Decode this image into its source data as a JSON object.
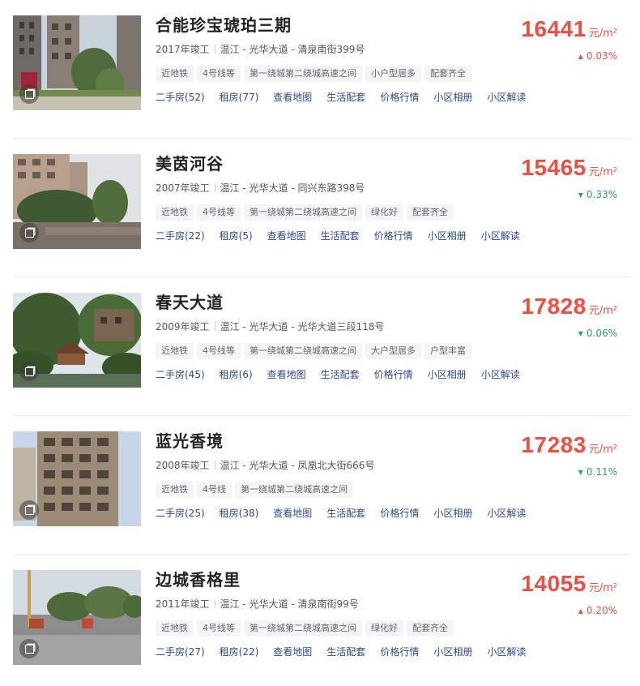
{
  "communities": [
    {
      "name": "合能珍宝琥珀三期",
      "year": "2017年竣工",
      "location": "温江 - 光华大道 - 清泉南街399号",
      "tags": [
        "近地铁",
        "4号线等",
        "第一绕城第二绕城高速之间",
        "小户型居多",
        "配套齐全"
      ],
      "links": [
        "二手房(52)",
        "租房(77)",
        "查看地图",
        "生活配套",
        "价格行情",
        "小区相册",
        "小区解读"
      ],
      "price": "16441",
      "unit": "元/m²",
      "change_dir": "up",
      "change_arrow": "▲",
      "change": "0.03%",
      "photo_icon": "photo-album-icon"
    },
    {
      "name": "美茵河谷",
      "year": "2007年竣工",
      "location": "温江 - 光华大道 - 同兴东路398号",
      "tags": [
        "近地铁",
        "4号线等",
        "第一绕城第二绕城高速之间",
        "绿化好",
        "配套齐全"
      ],
      "links": [
        "二手房(22)",
        "租房(5)",
        "查看地图",
        "生活配套",
        "价格行情",
        "小区相册",
        "小区解读"
      ],
      "price": "15465",
      "unit": "元/m²",
      "change_dir": "down",
      "change_arrow": "▼",
      "change": "0.33%",
      "photo_icon": "photo-album-icon"
    },
    {
      "name": "春天大道",
      "year": "2009年竣工",
      "location": "温江 - 光华大道 - 光华大道三段118号",
      "tags": [
        "近地铁",
        "4号线等",
        "第一绕城第二绕城高速之间",
        "大户型居多",
        "户型丰富"
      ],
      "links": [
        "二手房(45)",
        "租房(6)",
        "查看地图",
        "生活配套",
        "价格行情",
        "小区相册",
        "小区解读"
      ],
      "price": "17828",
      "unit": "元/m²",
      "change_dir": "down",
      "change_arrow": "▼",
      "change": "0.06%",
      "photo_icon": "photo-album-icon"
    },
    {
      "name": "蓝光香境",
      "year": "2008年竣工",
      "location": "温江 - 光华大道 - 凤凰北大街666号",
      "tags": [
        "近地铁",
        "4号线",
        "第一绕城第二绕城高速之间"
      ],
      "links": [
        "二手房(25)",
        "租房(38)",
        "查看地图",
        "生活配套",
        "价格行情",
        "小区相册",
        "小区解读"
      ],
      "price": "17283",
      "unit": "元/m²",
      "change_dir": "down",
      "change_arrow": "▼",
      "change": "0.11%",
      "photo_icon": "photo-album-icon"
    },
    {
      "name": "边城香格里",
      "year": "2011年竣工",
      "location": "温江 - 光华大道 - 清泉南街99号",
      "tags": [
        "近地铁",
        "4号线等",
        "第一绕城第二绕城高速之间",
        "绿化好",
        "配套齐全"
      ],
      "links": [
        "二手房(27)",
        "租房(22)",
        "查看地图",
        "生活配套",
        "价格行情",
        "小区相册",
        "小区解读"
      ],
      "price": "14055",
      "unit": "元/m²",
      "change_dir": "up",
      "change_arrow": "▲",
      "change": "0.20%",
      "photo_icon": "photo-album-icon"
    }
  ],
  "colors": {
    "price": "#f04e3e",
    "price_up": "#f04e3e",
    "price_down": "#2f9e6a",
    "link": "#2c4a8c",
    "tag_bg": "#f3f5f7"
  }
}
